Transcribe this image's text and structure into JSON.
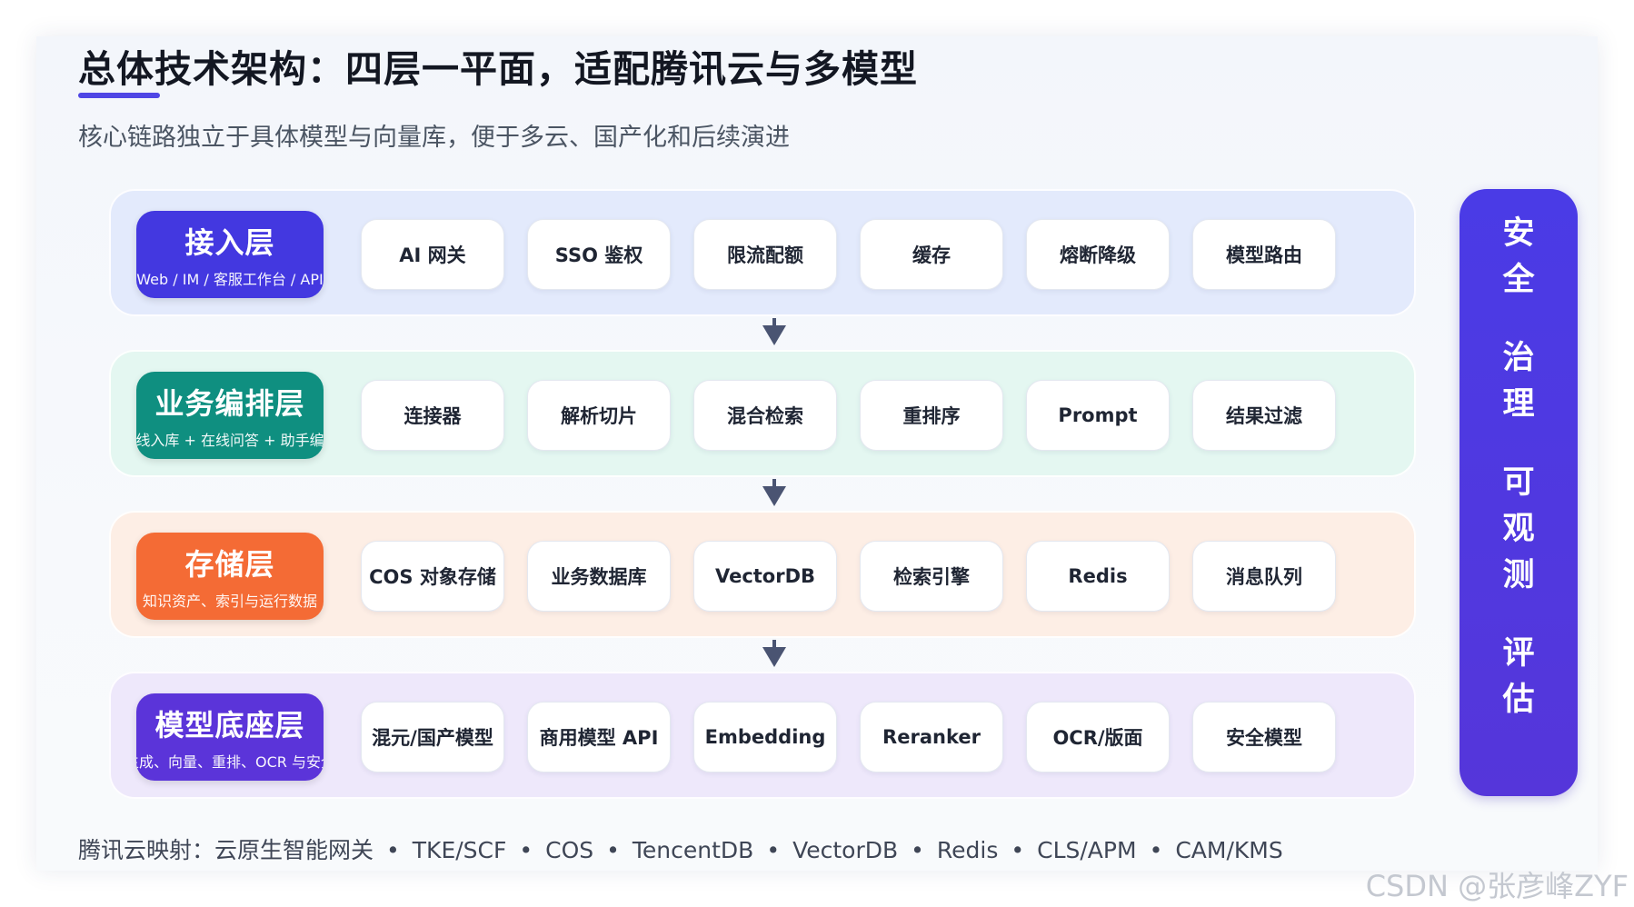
{
  "header": {
    "title": "总体技术架构：四层一平面，适配腾讯云与多模型",
    "subtitle": "核心链路独立于具体模型与向量库，便于多云、国产化和后续演进"
  },
  "layers": [
    {
      "title": "接入层",
      "subtitle": "Web / IM / 客服工作台 / API",
      "color": "#4338e0",
      "items": [
        "AI 网关",
        "SSO 鉴权",
        "限流配额",
        "缓存",
        "熔断降级",
        "模型路由"
      ]
    },
    {
      "title": "业务编排层",
      "subtitle": "离线入库 + 在线问答 + 助手编排",
      "color": "#0f8f80",
      "items": [
        "连接器",
        "解析切片",
        "混合检索",
        "重排序",
        "Prompt",
        "结果过滤"
      ]
    },
    {
      "title": "存储层",
      "subtitle": "知识资产、索引与运行数据",
      "color": "#f46b35",
      "items": [
        "COS 对象存储",
        "业务数据库",
        "VectorDB",
        "检索引擎",
        "Redis",
        "消息队列"
      ]
    },
    {
      "title": "模型底座层",
      "subtitle": "生成、向量、重排、OCR 与安全",
      "color": "#5b34d9",
      "items": [
        "混元/国产模型",
        "商用模型 API",
        "Embedding",
        "Reranker",
        "OCR/版面",
        "安全模型"
      ]
    }
  ],
  "side_panel": {
    "groups": [
      [
        "安",
        "全"
      ],
      [
        "治",
        "理"
      ],
      [
        "可",
        "观",
        "测"
      ],
      [
        "评",
        "估"
      ]
    ]
  },
  "footer": {
    "label": "腾讯云映射：",
    "items": [
      "云原生智能网关",
      "TKE/SCF",
      "COS",
      "TencentDB",
      "VectorDB",
      "Redis",
      "CLS/APM",
      "CAM/KMS"
    ],
    "separator": "•"
  },
  "watermark": "CSDN @张彦峰ZYF"
}
